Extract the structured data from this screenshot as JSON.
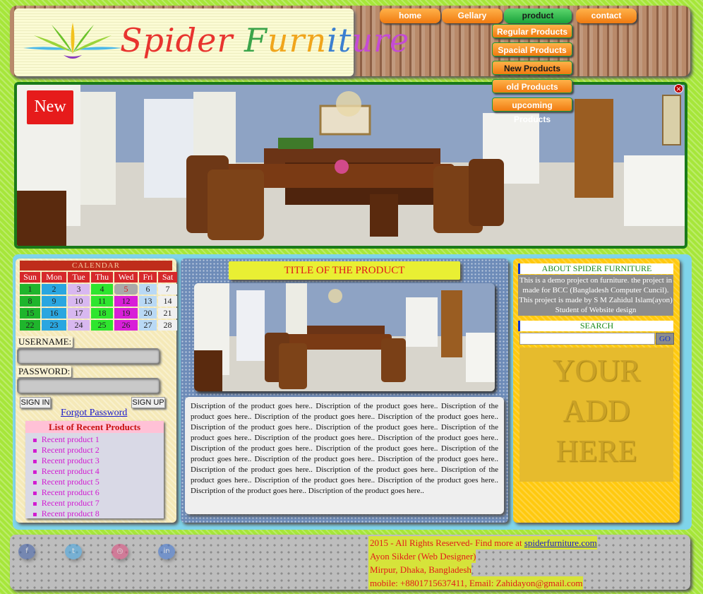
{
  "logo": {
    "part1": "Spider ",
    "part2": "F",
    "part3": "urn",
    "part4": "it",
    "part5": "ure"
  },
  "nav": {
    "items": [
      "home",
      "Gellary",
      "product",
      "contact"
    ],
    "active": "product"
  },
  "dropdown": [
    "Regular Products",
    "Spacial Products",
    "New Products",
    "old Products",
    "upcoming Products"
  ],
  "banner": {
    "badge": "New",
    "close_glyph": "×"
  },
  "calendar": {
    "title": "CALENDAR",
    "days": [
      "Sun",
      "Mon",
      "Tue",
      "Thu",
      "Wed",
      "Fri",
      "Sat"
    ],
    "weeks": [
      [
        "1",
        "2",
        "3",
        "4",
        "5",
        "6",
        "7"
      ],
      [
        "8",
        "9",
        "10",
        "11",
        "12",
        "13",
        "14"
      ],
      [
        "15",
        "16",
        "17",
        "18",
        "19",
        "20",
        "21"
      ],
      [
        "22",
        "23",
        "24",
        "25",
        "26",
        "27",
        "28"
      ]
    ],
    "column_colors": [
      "#1fb52c",
      "#2aa6e0",
      "#d8b8f0",
      "#2ee52e",
      "#d81fd8",
      "#b9d9f5",
      "#f0f0f0"
    ],
    "today": "5",
    "today_color": "#a9a9a9"
  },
  "login": {
    "username_label": "USERNAME:",
    "password_label": "PASSWORD:",
    "sign_in": "SIGN IN",
    "sign_up": "SIGN UP",
    "forgot": "Forgot Password"
  },
  "recent": {
    "title": "List of Recent Products",
    "items": [
      "Recent product 1",
      "Recent product 2",
      "Recent product 3",
      "Recent product 4",
      "Recent product 5",
      "Recent product 6",
      "Recent product 7",
      "Recent product 8"
    ]
  },
  "product": {
    "title": "TITLE OF THE PRODUCT",
    "description": "Discription of the product goes here.. Discription of the product goes here.. Discription of the product goes here.. Discription of the product goes here.. Discription of the product goes here.. Discription of the product goes here.. Discription of the product goes here.. Discription of the product goes here.. Discription of the product goes here.. Discription of the product goes here.. Discription of the product goes here.. Discription of the product goes here.. Discription of the product goes here.. Discription of the product goes here.. Discription of the product goes here.. Discription of the product goes here.. Discription of the product goes here.. Discription of the product goes here.. Discription of the product goes here.. Discription of the product goes here.. Discription of the product goes here.. Discription of the product goes here.."
  },
  "about": {
    "title": "ABOUT SPIDER FURNITURE",
    "text": "This is a demo project on furniture. the project in made for BCC (Bangladesh Computer Cuncil). This project is made by S M Zahidul Islam(ayon) Student of Website design"
  },
  "search": {
    "title": "SEARCH",
    "placeholder": "",
    "button": "GO"
  },
  "ad": {
    "line1": "YOUR",
    "line2": "ADD",
    "line3": "HERE"
  },
  "footer": {
    "copyright_prefix": "2015 - All Rights Reserved- Find more at ",
    "copyright_link": "spiderfurniture.com",
    "author": "Ayon Sikder (Web Designer)",
    "address": "Mirpur, Dhaka, Bangladesh",
    "contact": "mobile: +8801715637411, Email: Zahidayon@gmail.com"
  },
  "social": [
    {
      "icon": "facebook-icon",
      "glyph": "f",
      "color": "#3b5ba8"
    },
    {
      "icon": "twitter-icon",
      "glyph": "t",
      "color": "#3fa6e6"
    },
    {
      "icon": "instagram-icon",
      "glyph": "◎",
      "color": "#e0467a"
    },
    {
      "icon": "linkedin-icon",
      "glyph": "in",
      "color": "#3a72d4"
    }
  ]
}
